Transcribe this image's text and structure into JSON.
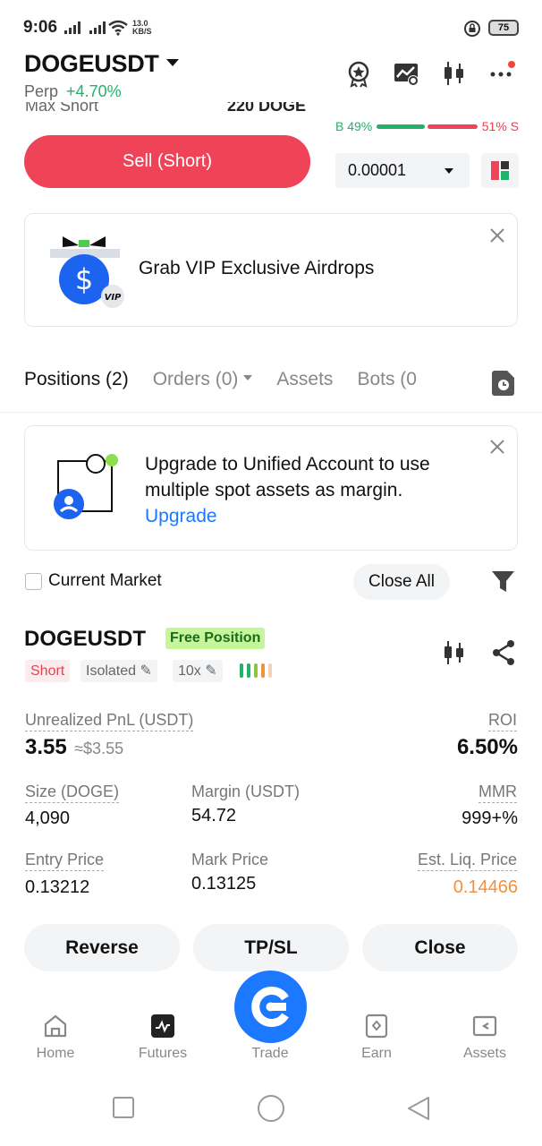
{
  "status_bar": {
    "time": "9:06",
    "speed_value": "13.0",
    "speed_unit": "KB/S",
    "battery": "75"
  },
  "header": {
    "pair": "DOGEUSDT",
    "contract_type": "Perp",
    "change": "+4.70%",
    "icons": [
      "badge-icon",
      "chart-settings-icon",
      "candlestick-icon",
      "more-icon"
    ]
  },
  "trade_panel": {
    "max_short_label": "Max Short",
    "max_short_value": "220 DOGE",
    "sell_button": "Sell (Short)",
    "buy_ratio": "B 49%",
    "sell_ratio": "51% S",
    "buy_ratio_value": 49,
    "sell_ratio_value": 51,
    "tick_size": "0.00001"
  },
  "vip_banner": {
    "text": "Grab VIP Exclusive Airdrops",
    "vip_badge": "VIP"
  },
  "tabs": {
    "positions": "Positions (2)",
    "orders": "Orders (0)",
    "assets": "Assets",
    "bots": "Bots (0"
  },
  "upgrade_card": {
    "text": "Upgrade to Unified Account to use multiple spot assets as margin.",
    "link": "Upgrade"
  },
  "filter_row": {
    "checkbox_label": "Current Market",
    "close_all": "Close All"
  },
  "position": {
    "symbol": "DOGEUSDT",
    "badge": "Free Position",
    "side": "Short",
    "margin_mode": "Isolated",
    "leverage": "10x",
    "unrealized_pnl_label": "Unrealized PnL (USDT)",
    "unrealized_pnl": "3.55",
    "unrealized_pnl_usd": "≈$3.55",
    "roi_label": "ROI",
    "roi": "6.50%",
    "size_label": "Size (DOGE)",
    "size": "4,090",
    "margin_label": "Margin (USDT)",
    "margin": "54.72",
    "mmr_label": "MMR",
    "mmr": "999+%",
    "entry_price_label": "Entry Price",
    "entry_price": "0.13212",
    "mark_price_label": "Mark Price",
    "mark_price": "0.13125",
    "liq_price_label": "Est. Liq. Price",
    "liq_price": "0.14466",
    "actions": {
      "reverse": "Reverse",
      "tpsl": "TP/SL",
      "close": "Close"
    }
  },
  "bottom_nav": {
    "home": "Home",
    "futures": "Futures",
    "trade": "Trade",
    "earn": "Earn",
    "assets": "Assets"
  },
  "colors": {
    "green": "#20b26c",
    "red": "#ef4458",
    "blue": "#1c79ff",
    "orange": "#f3913c"
  }
}
